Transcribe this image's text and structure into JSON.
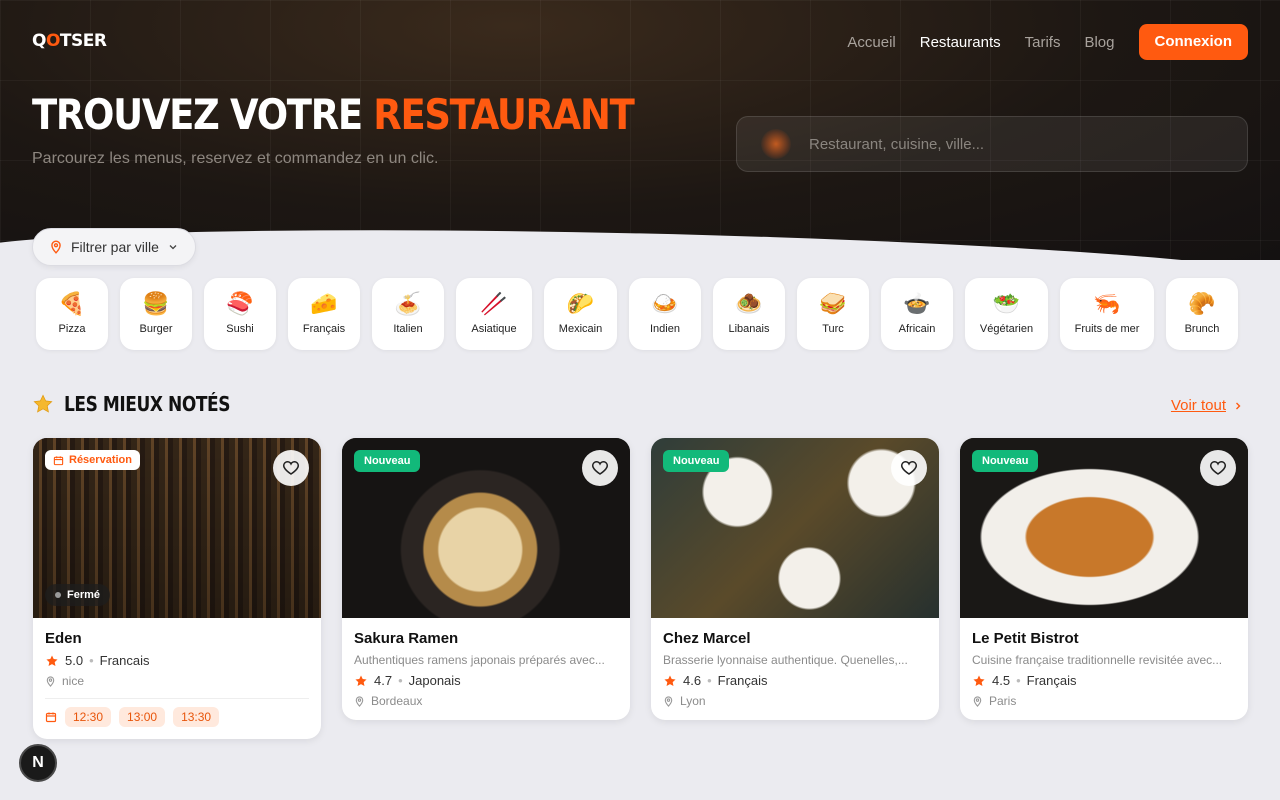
{
  "brand": {
    "logo": "Q🔥TSER",
    "logo_pre": "Q",
    "logo_mark": "O",
    "logo_post": "TSER",
    "accent_color": "#ff5a10"
  },
  "nav": {
    "items": [
      {
        "label": "Accueil",
        "active": false
      },
      {
        "label": "Restaurants",
        "active": true
      },
      {
        "label": "Tarifs",
        "active": false
      },
      {
        "label": "Blog",
        "active": false
      }
    ],
    "login_label": "Connexion"
  },
  "hero": {
    "title_main": "TROUVEZ VOTRE ",
    "title_accent": "RESTAURANT",
    "subtitle": "Parcourez les menus, reservez et commandez en un clic.",
    "search_placeholder": "Restaurant, cuisine, ville..."
  },
  "city_filter": {
    "label": "Filtrer par ville",
    "icon": "map-pin-icon"
  },
  "categories": [
    {
      "label": "Pizza",
      "emoji": "🍕"
    },
    {
      "label": "Burger",
      "emoji": "🍔"
    },
    {
      "label": "Sushi",
      "emoji": "🍣"
    },
    {
      "label": "Français",
      "emoji": "🧀"
    },
    {
      "label": "Italien",
      "emoji": "🍝"
    },
    {
      "label": "Asiatique",
      "emoji": "🥢"
    },
    {
      "label": "Mexicain",
      "emoji": "🌮"
    },
    {
      "label": "Indien",
      "emoji": "🍛"
    },
    {
      "label": "Libanais",
      "emoji": "🧆"
    },
    {
      "label": "Turc",
      "emoji": "🥪"
    },
    {
      "label": "Africain",
      "emoji": "🍲"
    },
    {
      "label": "Végétarien",
      "emoji": "🥗"
    },
    {
      "label": "Fruits de mer",
      "emoji": "🦐"
    },
    {
      "label": "Brunch",
      "emoji": "🥐"
    }
  ],
  "top_rated": {
    "title": "LES MIEUX NOTÉS",
    "see_all": "Voir tout",
    "restaurants": [
      {
        "name": "Eden",
        "rating": "5.0",
        "cuisine": "Francais",
        "location": "nice",
        "badge": "Réservation",
        "status": "Fermé",
        "slots": [
          "12:30",
          "13:00",
          "13:30"
        ]
      },
      {
        "name": "Sakura Ramen",
        "description": "Authentiques ramens japonais préparés avec...",
        "rating": "4.7",
        "cuisine": "Japonais",
        "location": "Bordeaux",
        "badge": "Nouveau"
      },
      {
        "name": "Chez Marcel",
        "description": "Brasserie lyonnaise authentique. Quenelles,...",
        "rating": "4.6",
        "cuisine": "Français",
        "location": "Lyon",
        "badge": "Nouveau"
      },
      {
        "name": "Le Petit Bistrot",
        "description": "Cuisine française traditionnelle revisitée avec...",
        "rating": "4.5",
        "cuisine": "Français",
        "location": "Paris",
        "badge": "Nouveau"
      }
    ]
  },
  "floating_button": {
    "label": "N"
  }
}
